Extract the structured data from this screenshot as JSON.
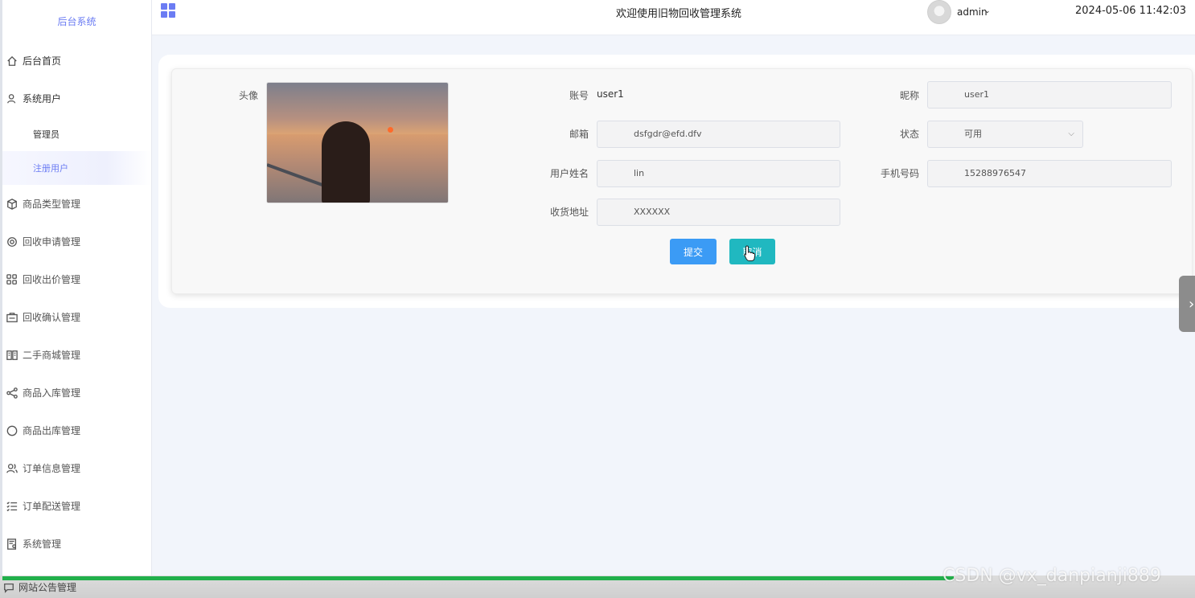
{
  "sidebar": {
    "brand": "后台系统",
    "home": "后台首页",
    "system_users": "系统用户",
    "sub_admin": "管理员",
    "sub_registered": "注册用户",
    "items": [
      {
        "label": "商品类型管理",
        "icon": "cube-icon"
      },
      {
        "label": "回收申请管理",
        "icon": "gear-icon"
      },
      {
        "label": "回收出价管理",
        "icon": "grid-icon"
      },
      {
        "label": "回收确认管理",
        "icon": "briefcase-icon"
      },
      {
        "label": "二手商城管理",
        "icon": "book-icon"
      },
      {
        "label": "商品入库管理",
        "icon": "share-icon"
      },
      {
        "label": "商品出库管理",
        "icon": "chat-icon"
      },
      {
        "label": "订单信息管理",
        "icon": "users-icon"
      },
      {
        "label": "订单配送管理",
        "icon": "list-icon"
      },
      {
        "label": "系统管理",
        "icon": "doc-settings-icon"
      }
    ],
    "bottom_item": "网站公告管理"
  },
  "header": {
    "welcome": "欢迎使用旧物回收管理系统",
    "user": "admin",
    "datetime": "2024-05-06 11:42:03"
  },
  "form": {
    "avatar_label": "头像",
    "account_label": "账号",
    "account_value": "user1",
    "nickname_label": "昵称",
    "nickname_value": "user1",
    "email_label": "邮箱",
    "email_value": "dsfgdr@efd.dfv",
    "status_label": "状态",
    "status_value": "可用",
    "realname_label": "用户姓名",
    "realname_value": "lin",
    "phone_label": "手机号码",
    "phone_value": "15288976547",
    "address_label": "收货地址",
    "address_value": "XXXXXX",
    "submit_label": "提交",
    "cancel_label": "取消"
  },
  "watermark": "CSDN @vx_danpianji889",
  "colors": {
    "accent": "#6b7cf3",
    "submit": "#3b9bf5",
    "cancel": "#20b8c0",
    "progress": "#21b04b"
  }
}
